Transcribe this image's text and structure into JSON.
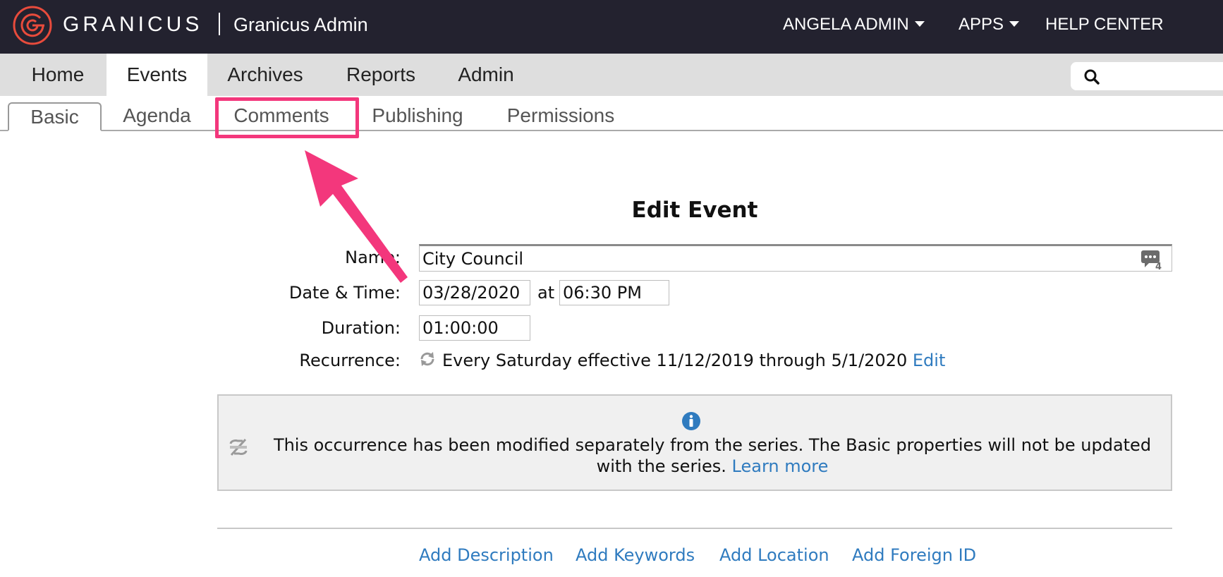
{
  "header": {
    "logo_text": "GRANICUS",
    "app_title": "Granicus Admin",
    "user_menu": "ANGELA ADMIN",
    "apps_menu": "APPS",
    "help_center": "HELP CENTER",
    "background_color": "#23222f",
    "logo_color": "#e84b3c"
  },
  "main_nav": {
    "items": [
      {
        "label": "Home"
      },
      {
        "label": "Events"
      },
      {
        "label": "Archives"
      },
      {
        "label": "Reports"
      },
      {
        "label": "Admin"
      }
    ],
    "active": "Events",
    "search_placeholder": ""
  },
  "sub_tabs": {
    "items": [
      {
        "label": "Basic"
      },
      {
        "label": "Agenda"
      },
      {
        "label": "Comments"
      },
      {
        "label": "Publishing"
      },
      {
        "label": "Permissions"
      }
    ],
    "active": "Basic",
    "highlighted": "Comments",
    "highlight_color": "#f3377c"
  },
  "form": {
    "title": "Edit Event",
    "name_label": "Name:",
    "name_value": "City Council",
    "comment_count": "4",
    "datetime_label": "Date & Time:",
    "date_value": "03/28/2020",
    "at_text": "at",
    "time_value": "06:30 PM",
    "duration_label": "Duration:",
    "duration_value": "01:00:00",
    "recurrence_label": "Recurrence:",
    "recurrence_text": "Every Saturday effective 11/12/2019 through 5/1/2020",
    "recurrence_edit": "Edit"
  },
  "notice": {
    "text_line1": "This occurrence has been modified separately from the series. The Basic properties will not be updated",
    "text_line2": "with the series.",
    "learn_more": "Learn more"
  },
  "add_links": [
    {
      "label": "Add Description"
    },
    {
      "label": "Add Keywords"
    },
    {
      "label": "Add Location"
    },
    {
      "label": "Add Foreign ID"
    }
  ],
  "link_color": "#2f7bbf"
}
